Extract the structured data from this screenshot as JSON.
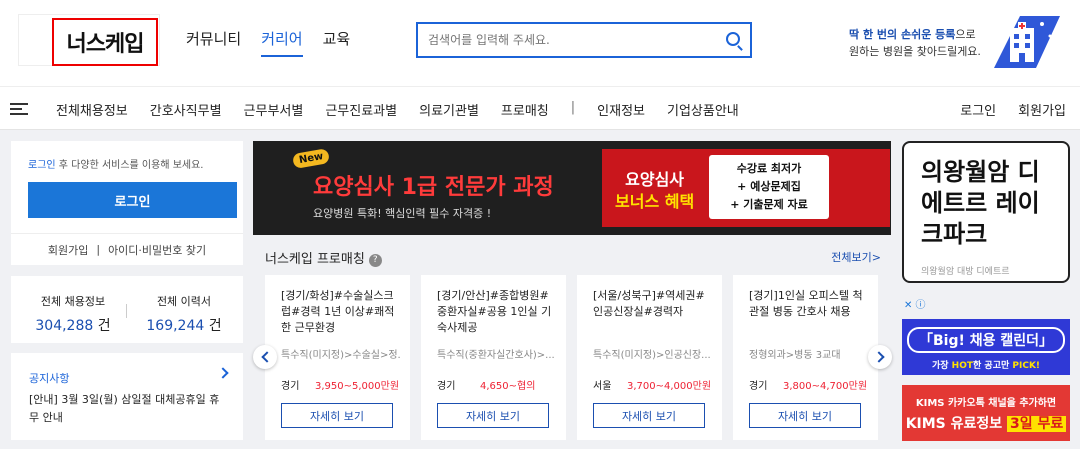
{
  "header": {
    "logo_text": "너스케입",
    "nav": [
      "커뮤니티",
      "커리어",
      "교육"
    ],
    "search_placeholder": "검색어를 입력해 주세요.",
    "promo_line1_highlight": "딱 한 번의 손쉬운 등록",
    "promo_line1_rest": "으로",
    "promo_line2": "원하는 병원을 찾아드릴게요."
  },
  "menu": {
    "items": [
      "전체채용정보",
      "간호사직무별",
      "근무부서별",
      "근무진료과별",
      "의료기관별",
      "프로매칭"
    ],
    "separator": "|",
    "items2": [
      "인재정보",
      "기업상품안내"
    ],
    "login": "로그인",
    "signup": "회원가입"
  },
  "login_card": {
    "hint_link": "로그인",
    "hint_rest": " 후 다양한 서비스를 이용해 보세요.",
    "button": "로그인",
    "signup": "회원가입",
    "sep": "|",
    "find": "아이디·비밀번호 찾기"
  },
  "stats": {
    "jobs_label": "전체 채용정보",
    "jobs_value": "304,288",
    "resumes_label": "전체 이력서",
    "resumes_value": "169,244",
    "unit": "건"
  },
  "notice": {
    "title": "공지사항",
    "text": "[안내] 3월 3일(월) 삼일절 대체공휴일 휴무 안내"
  },
  "banner": {
    "new": "New",
    "title_red": "요양심사",
    "title_rest": " 1급 전문가 과정",
    "subtitle": "요양병원 특화! 핵심인력 필수 자격증 !",
    "bonus_line1": "요양심사",
    "bonus_line2": "보너스 혜택",
    "benefits": [
      "수강료 최저가",
      "+ 예상문제집",
      "+ 기출문제 자료"
    ]
  },
  "promatching": {
    "title": "너스케입 프로매칭",
    "help": "?",
    "more": "전체보기>",
    "jobs": [
      {
        "title": "[경기/화성]#수술실스크럽#경력 1년 이상#쾌적한 근무환경",
        "dept": "특수직(미지정)>수술실>정...",
        "region": "경기",
        "pay": "3,950~5,000만원",
        "button": "자세히 보기"
      },
      {
        "title": "[경기/안산]#종합병원#중환자실#공용 1인실 기숙사제공",
        "dept": "특수직(중환자실간호사)>...",
        "region": "경기",
        "pay": "4,650~협의",
        "button": "자세히 보기"
      },
      {
        "title": "[서울/성북구]#역세권#인공신장실#경력자",
        "dept": "특수직(미지정)>인공신장...",
        "region": "서울",
        "pay": "3,700~4,000만원",
        "button": "자세히 보기"
      },
      {
        "title": "[경기]1인실 오피스텔 척관절 병동 간호사 채용",
        "dept": "정형외과>병동 3교대",
        "region": "경기",
        "pay": "3,800~4,700만원",
        "button": "자세히 보기"
      }
    ]
  },
  "ads": {
    "box_title": "의왕월암 디에트르 레이크파크",
    "box_sub": "의왕월암 대방 디에트르",
    "adchoice": "✕ ⓘ",
    "ad2_title": "「Big! 채용 캘린더」",
    "ad2_pre": "가장 ",
    "ad2_hot": "HOT",
    "ad2_rest": "한 공고만 ",
    "ad2_pick": "PICK!",
    "ad3_line1": "KIMS 카카오톡 채널을 추가하면",
    "ad3_line2_pre": "KIMS 유료정보 ",
    "ad3_line2_hl": "3일 무료"
  }
}
